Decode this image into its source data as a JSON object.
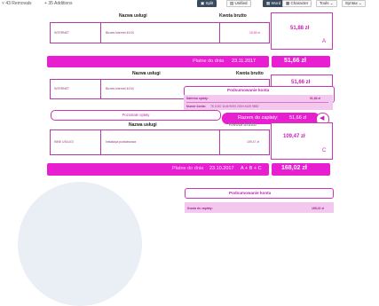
{
  "toolbar": {
    "removals": "43 Removals",
    "additions": "35 Additions",
    "split": "Split",
    "unified": "Unified",
    "word": "Word",
    "character": "Character",
    "tools": "Tools",
    "syntax": "Syntax"
  },
  "top_table": {
    "col_service": "Nazwa usługi",
    "col_gross": "Kwota brutto",
    "row_code": "INTERNET",
    "row_service": "Biznes Internet 40/10",
    "row_amount": "18,89 zł",
    "box_amount": "51,88 zł",
    "box_letter": "A"
  },
  "band1": {
    "label": "Płatne do dnia",
    "date": "23.11.2017",
    "amount": "51,66 zł"
  },
  "mid_table": {
    "col_service": "Nazwa usługi",
    "col_gross": "Kwota brutto",
    "row_code": "INTERNET",
    "row_service": "Biznes Internet 40/10",
    "box_amount": "51,66 zł",
    "box_letter": "B"
  },
  "summary_popup": {
    "title": "Podsumowanie konta",
    "due_label": "Należna opłaty:",
    "due_value": "51,66 zł",
    "account_label": "Numer konta:",
    "account_value": "76 1010 1146 9000 2300 4425 9852",
    "total_label": "Razem do zapłaty:",
    "total_value": "51,66 zł"
  },
  "other_fees": {
    "pill": "Pozostałe opłaty",
    "col_service": "Nazwa usługi",
    "col_gross": "Kwota brutto",
    "row_code": "INNE USŁUGI",
    "row_service": "Instalacja podstawowa",
    "row_amount": "109,47 zł",
    "box_amount": "109,47 zł",
    "box_letter": "C"
  },
  "band2": {
    "label": "Płatne do dnia",
    "date": "23.10.2017",
    "formula": "A + B + C",
    "amount": "168,02 zł"
  },
  "bottom_summary": {
    "title": "Podsumowanie konta",
    "due_label": "Kwota do zapłaty:",
    "due_value": "168,02 zł"
  },
  "colors": {
    "accent": "#e81fd0",
    "border": "#b43aa6",
    "toolbar_active": "#3a4a5e"
  }
}
